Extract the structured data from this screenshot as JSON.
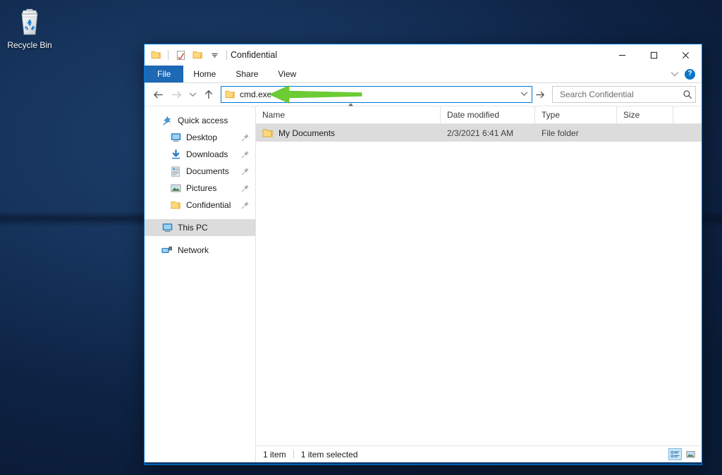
{
  "desktop": {
    "icons": [
      {
        "name": "recycle-bin",
        "label": "Recycle Bin"
      }
    ]
  },
  "window": {
    "title": "Confidential",
    "quick_access_toolbar": [
      {
        "name": "folder-icon",
        "tooltip": "Properties folder"
      },
      {
        "name": "properties-icon",
        "tooltip": "Properties"
      },
      {
        "name": "new-folder-icon",
        "tooltip": "New folder"
      },
      {
        "name": "chevron-down-icon",
        "tooltip": "Customize Quick Access Toolbar"
      }
    ],
    "controls": {
      "minimize": "─",
      "maximize": "☐",
      "close": "✕"
    },
    "ribbon": {
      "tabs": [
        {
          "label": "File",
          "active": true
        },
        {
          "label": "Home",
          "active": false
        },
        {
          "label": "Share",
          "active": false
        },
        {
          "label": "View",
          "active": false
        }
      ],
      "collapse_icon": "ˇ",
      "help_label": "?"
    }
  },
  "toolbar": {
    "back_icon": "←",
    "forward_icon": "→",
    "recent_icon": "ˇ",
    "up_icon": "↑",
    "go_icon": "→",
    "address_dropdown_icon": "ˇ"
  },
  "address": {
    "value": "cmd.exe"
  },
  "search": {
    "placeholder": "Search Confidential",
    "value": ""
  },
  "annotation": {
    "arrow": {
      "name": "green-arrow-pointer",
      "color": "#6ccc33",
      "direction": "left",
      "points_to": "cmd.exe"
    }
  },
  "nav_pane": {
    "items": [
      {
        "label": "Quick access",
        "icon": "star-pin-icon",
        "indent": 0,
        "selected": false,
        "pinned": false
      },
      {
        "label": "Desktop",
        "icon": "desktop-icon",
        "indent": 1,
        "selected": false,
        "pinned": true
      },
      {
        "label": "Downloads",
        "icon": "downloads-icon",
        "indent": 1,
        "selected": false,
        "pinned": true
      },
      {
        "label": "Documents",
        "icon": "documents-icon",
        "indent": 1,
        "selected": false,
        "pinned": true
      },
      {
        "label": "Pictures",
        "icon": "pictures-icon",
        "indent": 1,
        "selected": false,
        "pinned": true
      },
      {
        "label": "Confidential",
        "icon": "folder-icon",
        "indent": 1,
        "selected": false,
        "pinned": true
      },
      {
        "label": "This PC",
        "icon": "this-pc-icon",
        "indent": 0,
        "selected": true,
        "pinned": false
      },
      {
        "label": "Network",
        "icon": "network-icon",
        "indent": 0,
        "selected": false,
        "pinned": false
      }
    ]
  },
  "file_list": {
    "columns": [
      {
        "key": "name",
        "label": "Name",
        "sorted": true,
        "sort_direction": "asc"
      },
      {
        "key": "date",
        "label": "Date modified"
      },
      {
        "key": "type",
        "label": "Type"
      },
      {
        "key": "size",
        "label": "Size"
      }
    ],
    "rows": [
      {
        "name": "My Documents",
        "date": "2/3/2021 6:41 AM",
        "type": "File folder",
        "size": "",
        "icon": "folder-icon",
        "selected": true
      }
    ]
  },
  "status_bar": {
    "item_count": "1 item",
    "selection": "1 item selected",
    "views": [
      {
        "name": "details-view",
        "active": true
      },
      {
        "name": "large-icons-view",
        "active": false
      }
    ]
  },
  "colors": {
    "accent": "#0078d7",
    "file_tab": "#1d69b5",
    "arrow_green": "#6ccc33",
    "selection_gray": "#dcdcdc",
    "folder_yellow": "#ffd279"
  }
}
